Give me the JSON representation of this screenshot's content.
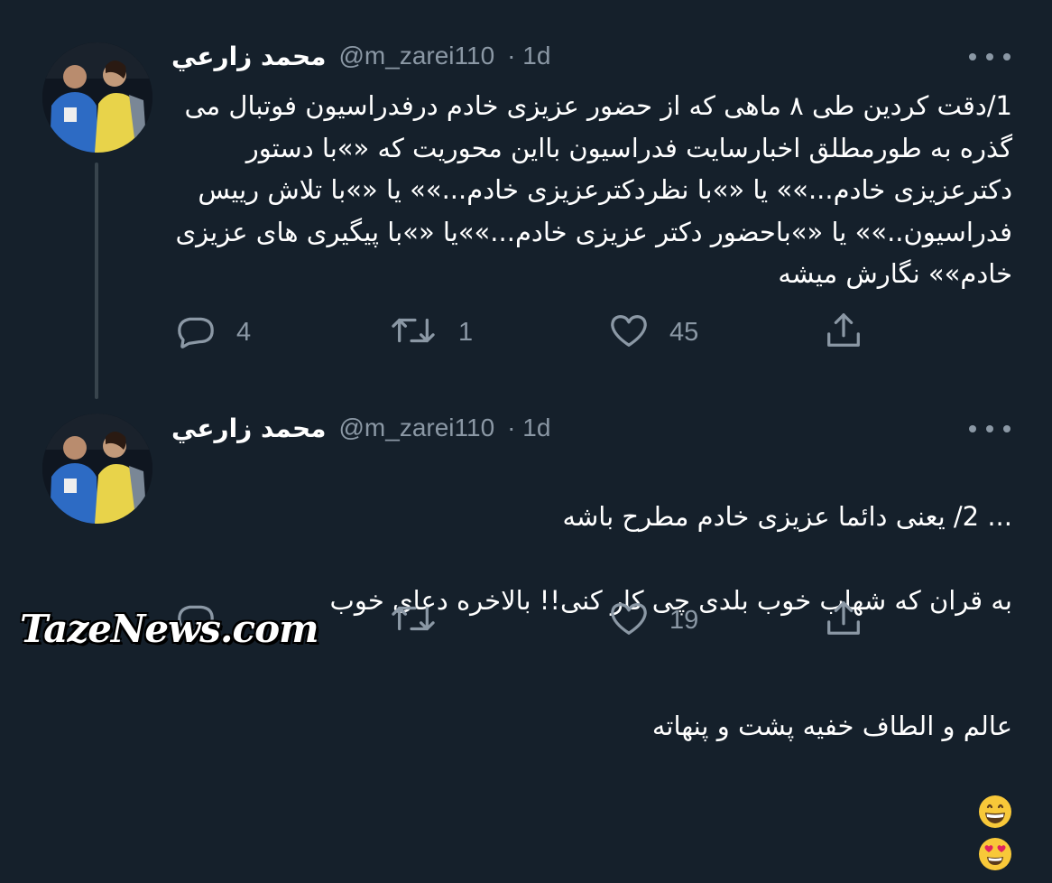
{
  "tweets": [
    {
      "name": "محمد زارعي",
      "handle": "@m_zarei110",
      "time": "· 1d",
      "text": "1/دقت کردین طی ۸ ماهی که از حضور عزیزی خادم درفدراسیون فوتبال می گذره به طورمطلق اخبارسایت فدراسیون بااین محوریت که «»با دستور دکترعزیزی خادم...»» یا «»با نظردکترعزیزی خادم...»» یا «»با تلاش رییس فدراسیون..»» یا «»باحضور دکتر عزیزی خادم...»»یا «»با پیگیری های عزیزی خادم»» نگارش میشه",
      "replies": "4",
      "retweets": "1",
      "likes": "45"
    },
    {
      "name": "محمد زارعي",
      "handle": "@m_zarei110",
      "time": "· 1d",
      "line1": "... 2/ یعنی دائما عزیزی خادم مطرح باشه",
      "line2": "به قران که شهاب خوب بلدی چی کار کنی!! بالاخره دعای خوب",
      "line3": "عالم و الطاف خفیه پشت و پنهاته",
      "emojis": [
        "grinning-face-emoji",
        "heart-eyes-emoji"
      ],
      "replies": "",
      "retweets": "",
      "likes": "19"
    }
  ],
  "icons": {
    "reply": "reply-icon",
    "retweet": "retweet-icon",
    "like": "like-icon",
    "share": "share-icon",
    "more": "more-icon"
  },
  "watermark": "TazeNews.com",
  "colors": {
    "background": "#15202b",
    "secondary_text": "#8b98a5",
    "thread_line": "#38444d"
  }
}
